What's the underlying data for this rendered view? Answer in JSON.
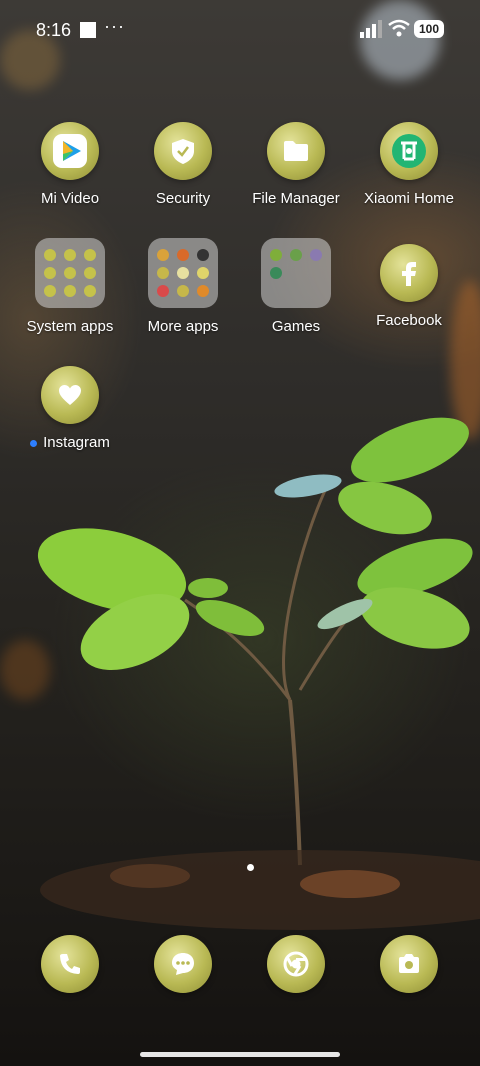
{
  "status_bar": {
    "time": "8:16",
    "more": "···",
    "battery": "100"
  },
  "apps": [
    {
      "label": "Mi Video"
    },
    {
      "label": "Security"
    },
    {
      "label": "File Manager"
    },
    {
      "label": "Xiaomi Home"
    },
    {
      "label": "System apps"
    },
    {
      "label": "More apps"
    },
    {
      "label": "Games"
    },
    {
      "label": "Facebook"
    },
    {
      "label": "Instagram"
    }
  ],
  "dock": [
    "phone-icon",
    "messages-icon",
    "chrome-icon",
    "camera-icon"
  ],
  "colors": {
    "icon_accent": "#b9b954",
    "notification_dot": "#2d7fff"
  }
}
